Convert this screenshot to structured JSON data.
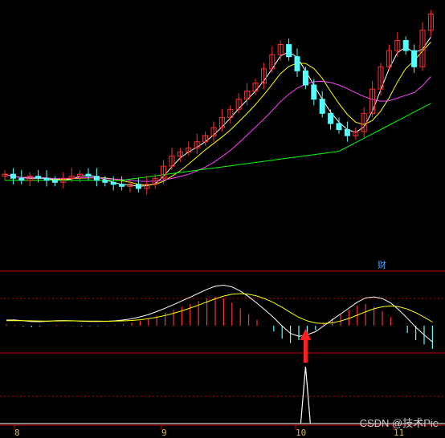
{
  "chart_data": {
    "type": "candlestick",
    "panels": [
      "price",
      "macd",
      "signal"
    ],
    "colors": {
      "up": "#ff3030",
      "down": "#54ffff",
      "ma5": "#ffffff",
      "ma10": "#ffff00",
      "ma20": "#ff40ff",
      "ma60": "#00ff00",
      "macd_dif": "#ffffff",
      "macd_dea": "#ffff00",
      "frame": "#c00000",
      "arrow": "#ff2020"
    },
    "x_tick_labels": [
      "8",
      "9",
      "10",
      "11"
    ],
    "price_trend": [
      33,
      31,
      30,
      32,
      31,
      30,
      29,
      31,
      32,
      33,
      32,
      30,
      29,
      28,
      27,
      28,
      26,
      28,
      31,
      37,
      42,
      44,
      46,
      49,
      52,
      56,
      61,
      65,
      70,
      74,
      78,
      85,
      92,
      97,
      91,
      84,
      77,
      70,
      63,
      58,
      55,
      52,
      54,
      63,
      75,
      86,
      94,
      99,
      94,
      86,
      104,
      112
    ],
    "macd_hist": [
      0.1,
      0.05,
      -0.05,
      -0.1,
      -0.05,
      0.02,
      0.05,
      0.03,
      -0.02,
      -0.05,
      -0.04,
      -0.03,
      -0.02,
      0.05,
      0.1,
      0.2,
      0.35,
      0.5,
      0.7,
      0.9,
      1.1,
      1.3,
      1.5,
      1.7,
      1.9,
      2.0,
      1.9,
      1.6,
      1.2,
      0.8,
      0.4,
      0.0,
      -0.4,
      -0.9,
      -1.2,
      -1.0,
      -0.6,
      -0.3,
      0.2,
      0.5,
      0.8,
      1.1,
      1.4,
      1.5,
      1.3,
      1.0,
      0.6,
      0.0,
      -0.5,
      -1.0,
      -1.3,
      -1.6
    ],
    "signal_peak_index": 36,
    "glyph": "财"
  },
  "watermark": "CSDN @技术Pie"
}
